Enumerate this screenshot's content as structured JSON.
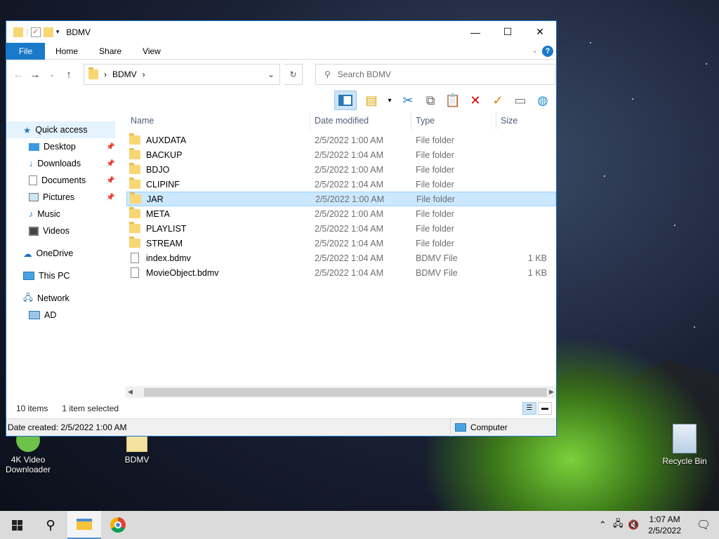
{
  "desktop": {
    "icons": [
      {
        "label": "4K Video Downloader"
      },
      {
        "label": "BDMV"
      },
      {
        "label": "Recycle Bin"
      }
    ]
  },
  "window": {
    "title": "BDMV",
    "controls": {
      "minimize": "—",
      "maximize": "☐",
      "close": "✕"
    },
    "ribbon_tabs": [
      "File",
      "Home",
      "Share",
      "View"
    ],
    "address": {
      "folder": "BDMV",
      "separator": "›"
    },
    "search_placeholder": "Search BDMV",
    "columns": {
      "name": "Name",
      "date": "Date modified",
      "type": "Type",
      "size": "Size"
    },
    "files": [
      {
        "name": "AUXDATA",
        "date": "2/5/2022 1:00 AM",
        "type": "File folder",
        "size": "",
        "kind": "folder"
      },
      {
        "name": "BACKUP",
        "date": "2/5/2022 1:04 AM",
        "type": "File folder",
        "size": "",
        "kind": "folder"
      },
      {
        "name": "BDJO",
        "date": "2/5/2022 1:00 AM",
        "type": "File folder",
        "size": "",
        "kind": "folder"
      },
      {
        "name": "CLIPINF",
        "date": "2/5/2022 1:04 AM",
        "type": "File folder",
        "size": "",
        "kind": "folder"
      },
      {
        "name": "JAR",
        "date": "2/5/2022 1:00 AM",
        "type": "File folder",
        "size": "",
        "kind": "folder",
        "selected": true
      },
      {
        "name": "META",
        "date": "2/5/2022 1:00 AM",
        "type": "File folder",
        "size": "",
        "kind": "folder"
      },
      {
        "name": "PLAYLIST",
        "date": "2/5/2022 1:04 AM",
        "type": "File folder",
        "size": "",
        "kind": "folder"
      },
      {
        "name": "STREAM",
        "date": "2/5/2022 1:04 AM",
        "type": "File folder",
        "size": "",
        "kind": "folder"
      },
      {
        "name": "index.bdmv",
        "date": "2/5/2022 1:04 AM",
        "type": "BDMV File",
        "size": "1 KB",
        "kind": "file"
      },
      {
        "name": "MovieObject.bdmv",
        "date": "2/5/2022 1:04 AM",
        "type": "BDMV File",
        "size": "1 KB",
        "kind": "file"
      }
    ],
    "nav": {
      "quick_access": "Quick access",
      "desktop": "Desktop",
      "downloads": "Downloads",
      "documents": "Documents",
      "pictures": "Pictures",
      "music": "Music",
      "videos": "Videos",
      "onedrive": "OneDrive",
      "this_pc": "This PC",
      "network": "Network",
      "ad": "AD"
    },
    "status": {
      "items": "10 items",
      "selected": "1 item selected"
    },
    "details": {
      "created": "Date created: 2/5/2022 1:00 AM",
      "location": "Computer"
    }
  },
  "taskbar": {
    "time": "1:07 AM",
    "date": "2/5/2022"
  }
}
